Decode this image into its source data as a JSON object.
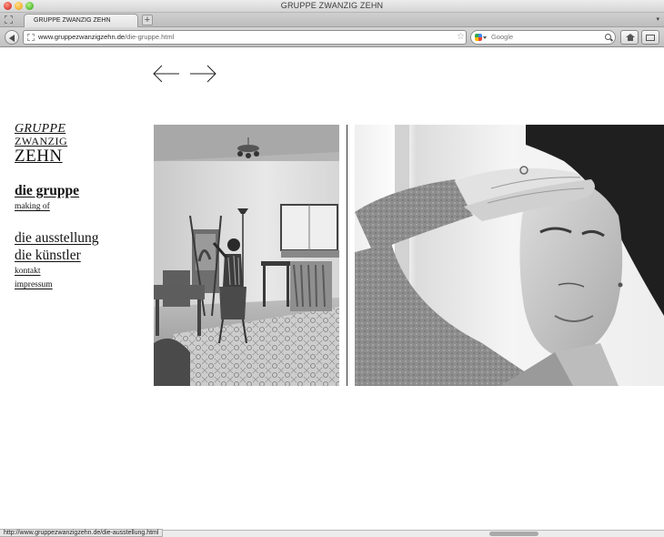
{
  "window": {
    "title": "GRUPPE ZWANZIG ZEHN"
  },
  "tabs": [
    {
      "label": "GRUPPE ZWANZIG ZEHN",
      "active": true
    }
  ],
  "toolbar": {
    "new_tab_symbol": "+",
    "tab_menu_symbol": "▾",
    "url_domain": "www.gruppezwanzigzehn.de",
    "url_path": "/die-gruppe.html",
    "star_symbol": "☆ ▾",
    "reload_symbol": "C",
    "search_placeholder": "Google"
  },
  "page": {
    "prev_arrow_icon": "arrow-left-icon",
    "next_arrow_icon": "arrow-right-icon",
    "logo": {
      "line1": "GRUPPE",
      "line2": "ZWANZIG",
      "line3": "ZEHN"
    },
    "menu": {
      "die_gruppe": "die gruppe",
      "making_of": "making of",
      "die_ausstellung": "die ausstellung",
      "die_kuenstler": "die künstler",
      "kontakt": "kontakt",
      "impressum": "impressum"
    }
  },
  "statusbar": {
    "hover_url": "http://www.gruppezwanzigzehn.de/die-ausstellung.html"
  },
  "colors": {
    "link": "#111111",
    "chrome": "#d0d0d0",
    "photo_divider": "#333333"
  }
}
